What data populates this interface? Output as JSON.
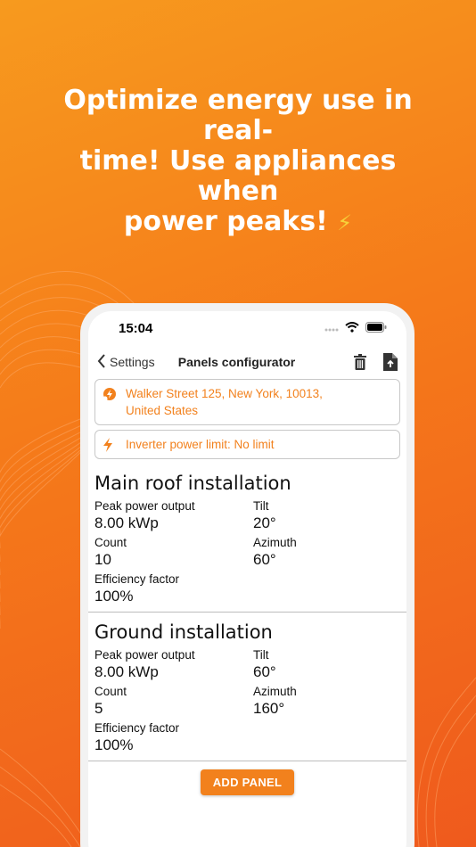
{
  "promo": {
    "line1": "Optimize energy use in real-",
    "line2": "time! Use appliances when",
    "line3": "power peaks!",
    "emoji": "⚡"
  },
  "status_bar": {
    "time": "15:04"
  },
  "nav": {
    "back_label": "Settings",
    "title": "Panels configurator",
    "icons": [
      "trash-icon",
      "export-file-icon"
    ]
  },
  "location": {
    "icon": "location-bolt-icon",
    "line1": "Walker Street 125, New York, 10013,",
    "line2": "United States"
  },
  "inverter": {
    "icon": "bolt-icon",
    "text": "Inverter power limit: No limit"
  },
  "installations": [
    {
      "title": "Main roof installation",
      "peak_label": "Peak power output",
      "peak_value": "8.00 kWp",
      "tilt_label": "Tilt",
      "tilt_value": "20°",
      "count_label": "Count",
      "count_value": "10",
      "azimuth_label": "Azimuth",
      "azimuth_value": "60°",
      "efficiency_label": "Efficiency factor",
      "efficiency_value": "100%"
    },
    {
      "title": "Ground installation",
      "peak_label": "Peak power output",
      "peak_value": "8.00 kWp",
      "tilt_label": "Tilt",
      "tilt_value": "60°",
      "count_label": "Count",
      "count_value": "5",
      "azimuth_label": "Azimuth",
      "azimuth_value": "160°",
      "efficiency_label": "Efficiency factor",
      "efficiency_value": "100%"
    }
  ],
  "add_button": "ADD PANEL",
  "colors": {
    "accent": "#f2811d",
    "background_start": "#f79a1e",
    "background_end": "#ef5a1d"
  }
}
